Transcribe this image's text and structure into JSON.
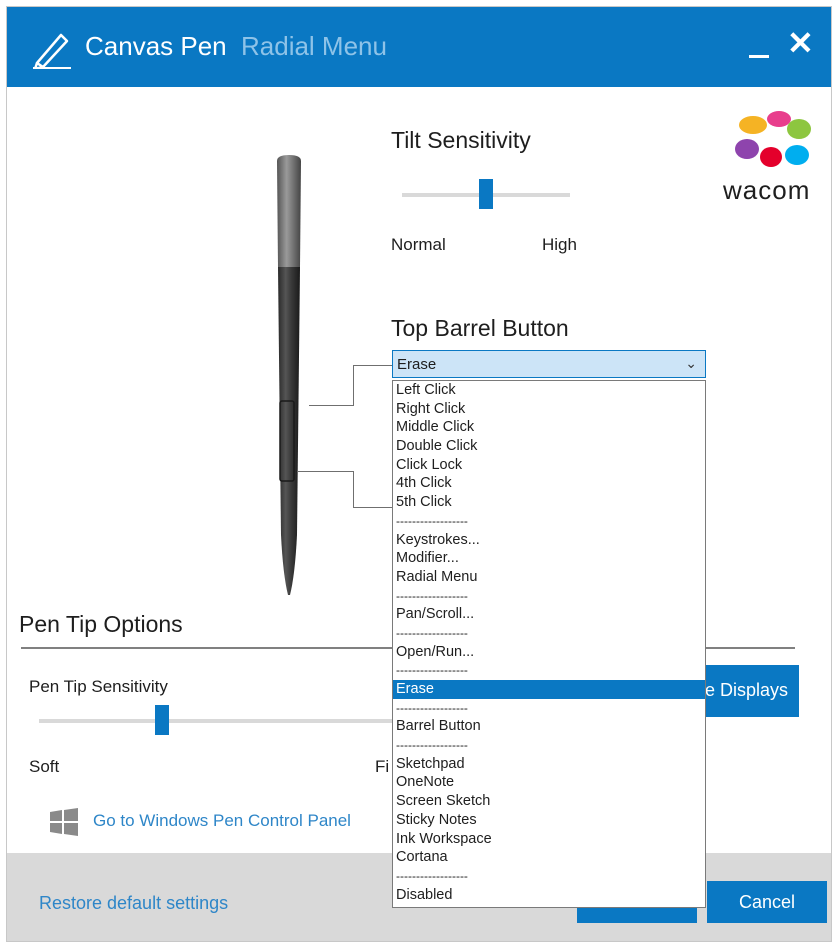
{
  "window": {
    "title": "Canvas Pen",
    "subtitle": "Radial Menu",
    "minimize_label": "_",
    "close_label": "✕",
    "accent": "#0a78c3"
  },
  "tilt": {
    "heading": "Tilt Sensitivity",
    "min_label": "Normal",
    "max_label": "High",
    "level": 0.5
  },
  "logo": {
    "text": "wacom"
  },
  "barrel": {
    "heading": "Top Barrel Button",
    "selected": "Erase",
    "options": [
      "Left Click",
      "Right Click",
      "Middle Click",
      "Double Click",
      "Click Lock",
      "4th Click",
      "5th Click",
      "------------------",
      "Keystrokes...",
      "Modifier...",
      "Radial Menu",
      "------------------",
      "Pan/Scroll...",
      "------------------",
      "Open/Run...",
      "------------------",
      "Erase",
      "------------------",
      "Barrel Button",
      "------------------",
      "Sketchpad",
      "OneNote",
      "Screen Sketch",
      "Sticky Notes",
      "Ink Workspace",
      "Cortana",
      "------------------",
      "Disabled"
    ]
  },
  "pen_tip": {
    "heading": "Pen Tip Options",
    "sensitivity_label": "Pen Tip Sensitivity",
    "min_label": "Soft",
    "max_label_partial": "Fi",
    "level": 0.35,
    "displays_button": "e Displays",
    "windows_link": "Go to Windows Pen Control Panel"
  },
  "footer": {
    "restore_link": "Restore default settings",
    "cancel_label": "Cancel"
  }
}
